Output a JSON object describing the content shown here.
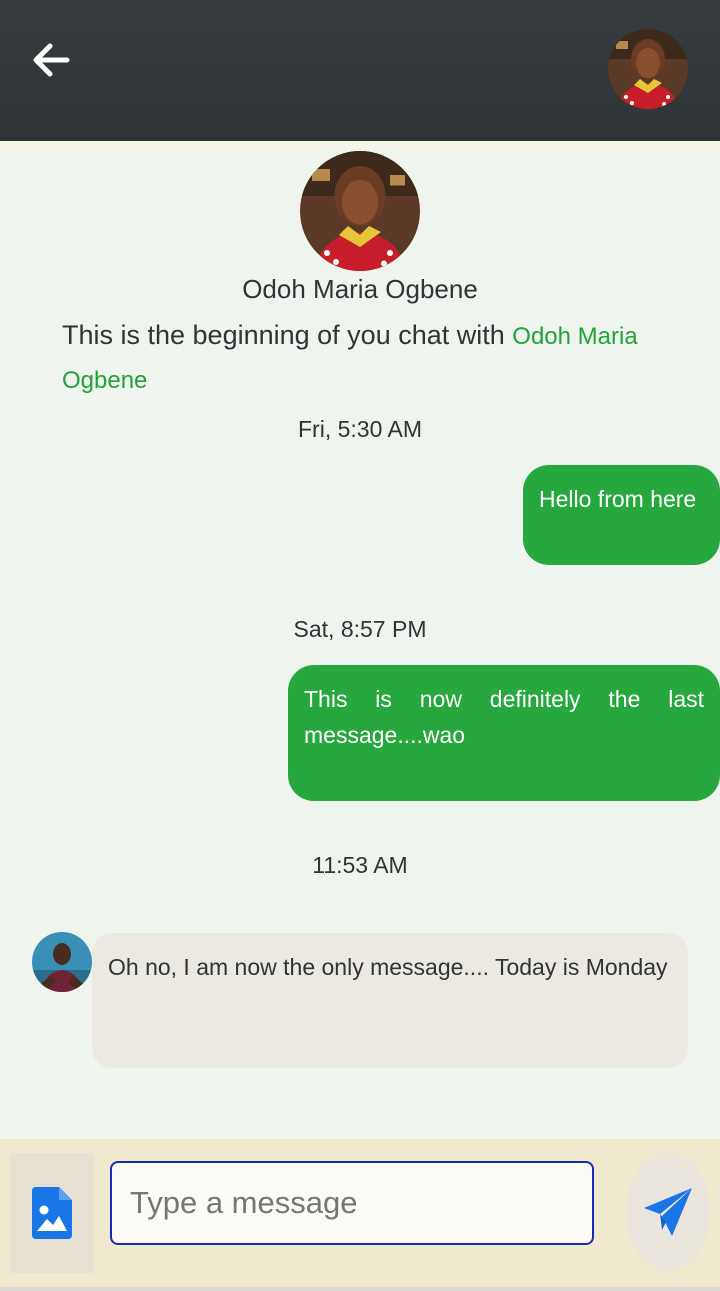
{
  "header": {
    "back_icon": "arrow-left-icon",
    "avatar_alt": "Contact avatar"
  },
  "profile": {
    "name": "Odoh Maria Ogbene",
    "intro_prefix": "This is the beginning of you chat with",
    "intro_name": "Odoh Maria Ogbene"
  },
  "messages": [
    {
      "time": "Fri, 5:30 AM",
      "direction": "outgoing",
      "text": "Hello from here"
    },
    {
      "time": "Sat, 8:57 PM",
      "direction": "outgoing",
      "text": "This is now definitely the last message....wao"
    },
    {
      "time": "11:53 AM",
      "direction": "incoming",
      "text": "Oh no, I am now the only message.... Today is Monday"
    }
  ],
  "composer": {
    "placeholder": "Type a message",
    "value": "",
    "attach_icon": "image-file-icon",
    "send_icon": "send-icon"
  },
  "colors": {
    "header_bg": "#373c3f",
    "accent_green": "#26a83e",
    "incoming_bubble": "#ece8e2",
    "composer_bg": "#efe9cd",
    "send_blue": "#1876e6"
  }
}
